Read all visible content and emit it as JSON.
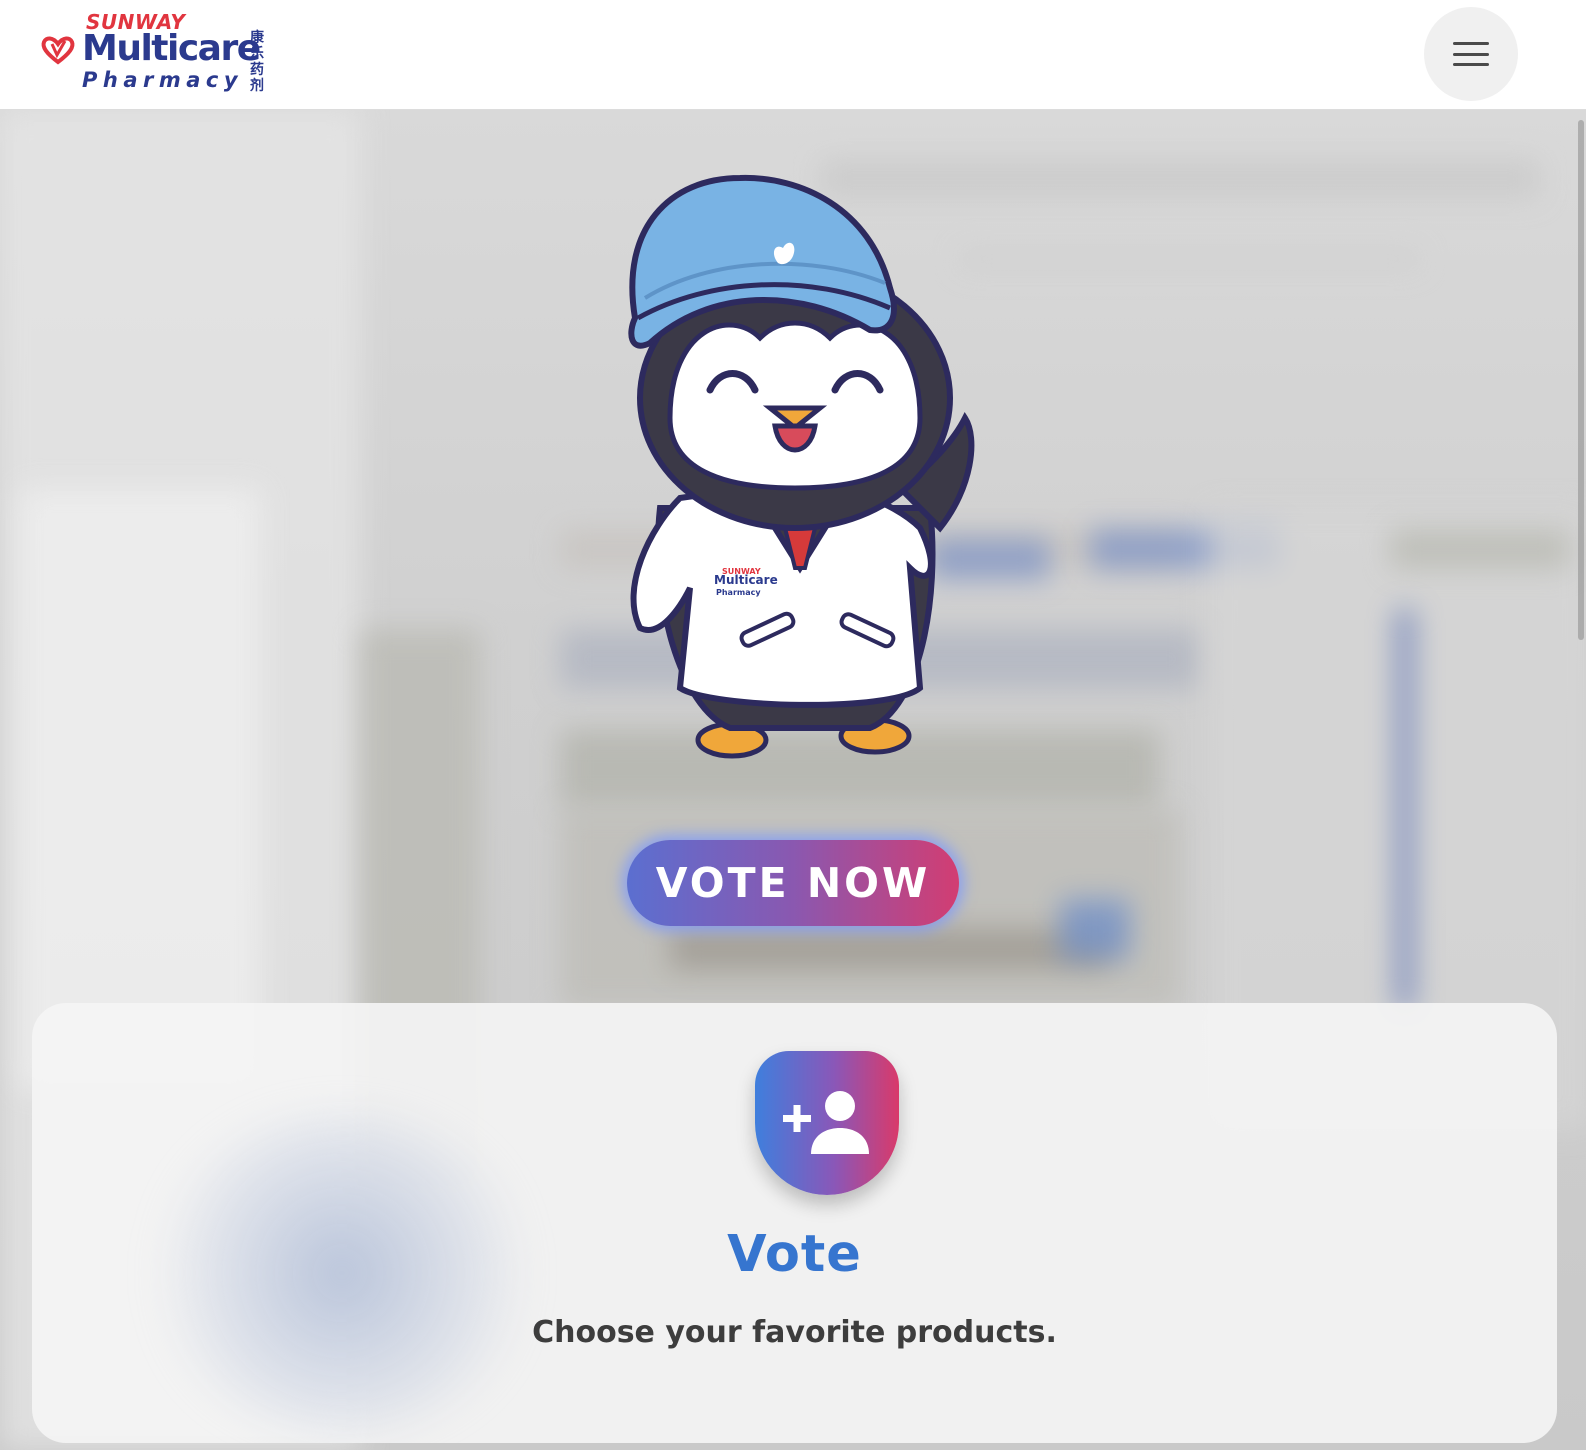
{
  "header": {
    "brand_top": "SUNWAY",
    "brand_main": "Multicare",
    "brand_sub": "Pharmacy",
    "brand_cn": "康乐药剂",
    "menu_icon": "hamburger-menu-icon"
  },
  "hero": {
    "mascot": "penguin-pharmacist-mascot",
    "mascot_coat_brand_top": "SUNWAY",
    "mascot_coat_brand_main": "Multicare",
    "mascot_coat_brand_sub": "Pharmacy",
    "vote_now_label": "VOTE NOW"
  },
  "card": {
    "icon": "add-user-icon",
    "title": "Vote",
    "description": "Choose your favorite products."
  },
  "colors": {
    "brand_red": "#e1353f",
    "brand_navy": "#2b3a8e",
    "accent_blue": "#3675cf",
    "gradient_start": "#5b6fd0",
    "gradient_end": "#d23d72"
  }
}
